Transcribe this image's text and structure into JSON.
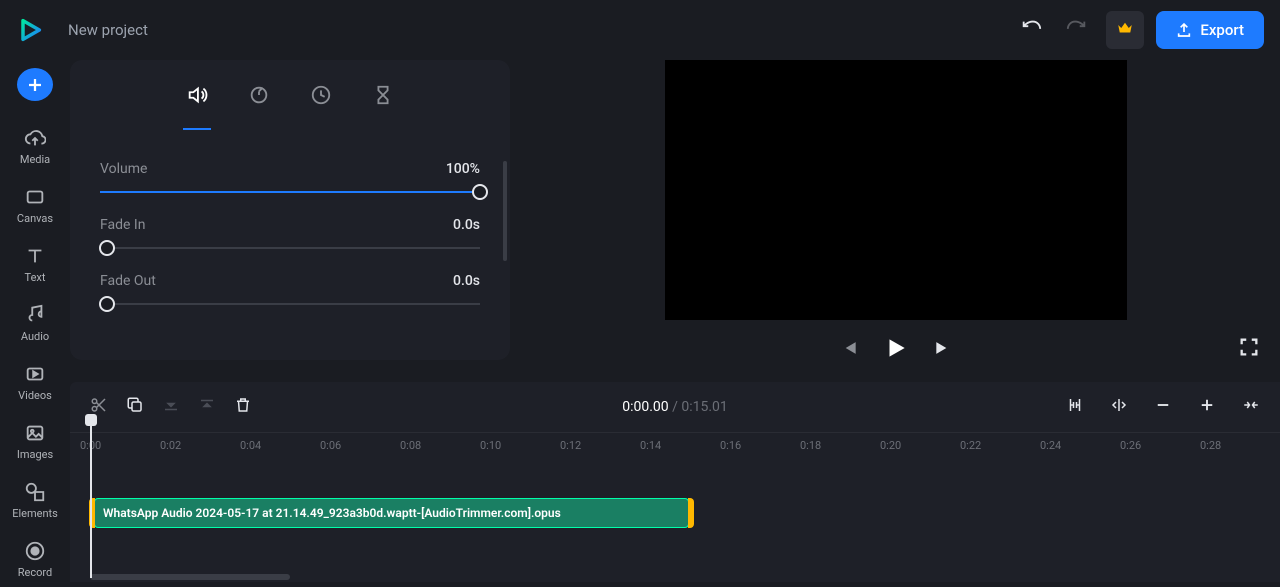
{
  "header": {
    "project_title": "New project",
    "export_label": "Export"
  },
  "sidebar": {
    "items": [
      {
        "label": "Media"
      },
      {
        "label": "Canvas"
      },
      {
        "label": "Text"
      },
      {
        "label": "Audio"
      },
      {
        "label": "Videos"
      },
      {
        "label": "Images"
      },
      {
        "label": "Elements"
      },
      {
        "label": "Record"
      }
    ]
  },
  "props": {
    "volume_label": "Volume",
    "volume_value": "100%",
    "fadein_label": "Fade In",
    "fadein_value": "0.0s",
    "fadeout_label": "Fade Out",
    "fadeout_value": "0.0s"
  },
  "timeline": {
    "current_time": "0:00.00",
    "separator": "  /  ",
    "total_time": "0:15.01",
    "ticks": [
      "0:00",
      "0:02",
      "0:04",
      "0:06",
      "0:08",
      "0:10",
      "0:12",
      "0:14",
      "0:16",
      "0:18",
      "0:20",
      "0:22",
      "0:24",
      "0:26",
      "0:28"
    ],
    "clip_name": "WhatsApp Audio 2024-05-17 at 21.14.49_923a3b0d.waptt-[AudioTrimmer.com].opus"
  }
}
